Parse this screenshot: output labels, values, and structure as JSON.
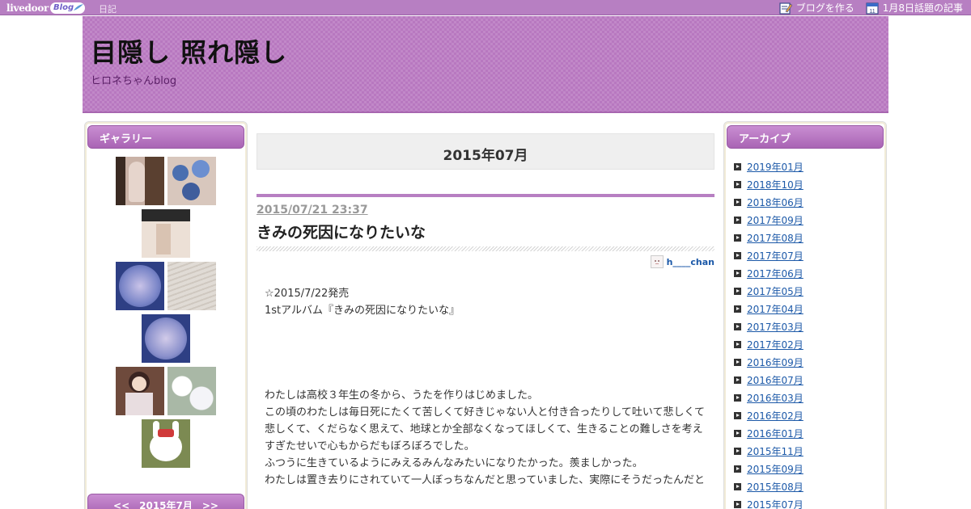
{
  "topbar": {
    "logo_text": "livedoor",
    "logo_badge": "Blog",
    "diary_link": "日記",
    "create_blog": "ブログを作る",
    "trending": "1月8日話題の記事",
    "calendar_day": "11"
  },
  "header": {
    "title": "目隠し 照れ隠し",
    "subtitle": "ヒロネちゃんblog"
  },
  "gallery": {
    "heading": "ギャラリー",
    "calendar_nav": "<<　2015年7月　>>"
  },
  "main": {
    "month_heading": "2015年07月",
    "post": {
      "date": "2015/07/21 23:37",
      "title": "きみの死因になりたいな",
      "author": "h____chan",
      "lines_top": [
        "☆2015/7/22発売",
        "1stアルバム『きみの死因になりたいな』"
      ],
      "lines_body": [
        "わたしは高校３年生の冬から、うたを作りはじめました。",
        "この頃のわたしは毎日死にたくて苦しくて好きじゃない人と付き合ったりして吐いて悲しくて",
        "悲しくて、くだらなく思えて、地球とか全部なくなってほしくて、生きることの難しさを考え",
        "すぎたせいで心もからだもぼろぼろでした。",
        "ふつうに生きているようにみえるみんなみたいになりたかった。羨ましかった。",
        "わたしは置き去りにされていて一人ぼっちなんだと思っていました、実際にそうだったんだと"
      ]
    }
  },
  "archive": {
    "heading": "アーカイブ",
    "items": [
      "2019年01月",
      "2018年10月",
      "2018年06月",
      "2017年09月",
      "2017年08月",
      "2017年07月",
      "2017年06月",
      "2017年05月",
      "2017年04月",
      "2017年03月",
      "2017年02月",
      "2016年09月",
      "2016年07月",
      "2016年03月",
      "2016年02月",
      "2016年01月",
      "2015年11月",
      "2015年09月",
      "2015年08月",
      "2015年07月"
    ]
  },
  "colors": {
    "accent": "#b77fc2",
    "link": "#1c59a8"
  }
}
